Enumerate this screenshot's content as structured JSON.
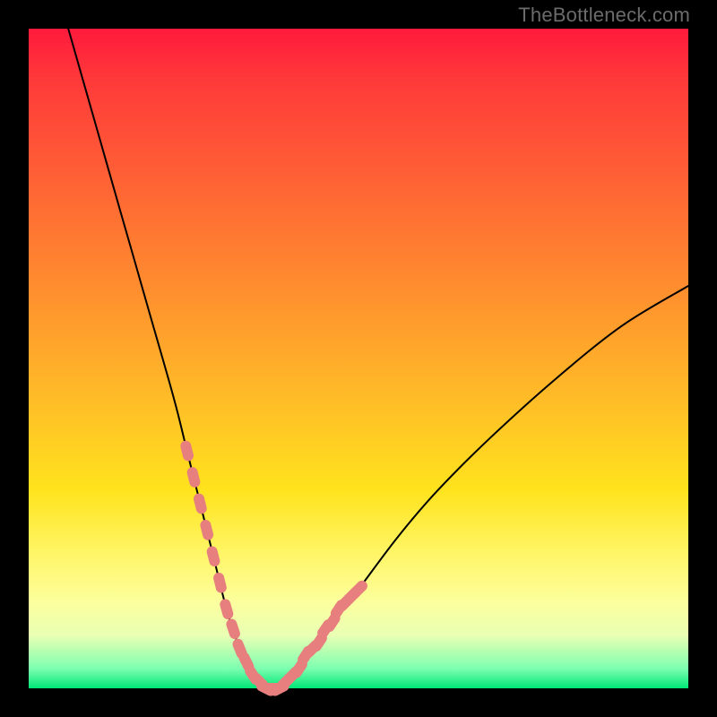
{
  "attribution": "TheBottleneck.com",
  "chart_data": {
    "type": "line",
    "title": "",
    "xlabel": "",
    "ylabel": "",
    "xlim": [
      0,
      100
    ],
    "ylim": [
      0,
      100
    ],
    "series": [
      {
        "name": "bottleneck-curve",
        "x": [
          6,
          10,
          14,
          18,
          22,
          24,
          26,
          28,
          30,
          32,
          34,
          36,
          38,
          40,
          44,
          50,
          56,
          62,
          70,
          80,
          90,
          100
        ],
        "y": [
          100,
          86,
          72,
          58,
          44,
          36,
          28,
          20,
          12,
          6,
          2,
          0,
          0,
          2,
          7,
          15,
          23,
          30,
          38,
          47,
          55,
          61
        ]
      }
    ],
    "highlight": {
      "name": "within-tolerance-markers",
      "color": "#e77f7f",
      "x": [
        24,
        25,
        26,
        27,
        28,
        29,
        30,
        31,
        32,
        33,
        34,
        35,
        36,
        37,
        38,
        39,
        40,
        41,
        42,
        43,
        44,
        45,
        46,
        47,
        48,
        49,
        50
      ],
      "y": [
        36,
        32,
        28,
        24,
        20,
        16,
        12,
        9,
        6,
        4,
        2,
        1,
        0,
        0,
        0,
        1,
        2,
        3,
        5,
        6,
        7,
        9,
        10,
        12,
        13,
        14,
        15
      ]
    },
    "green_band_y": [
      0,
      4
    ]
  }
}
